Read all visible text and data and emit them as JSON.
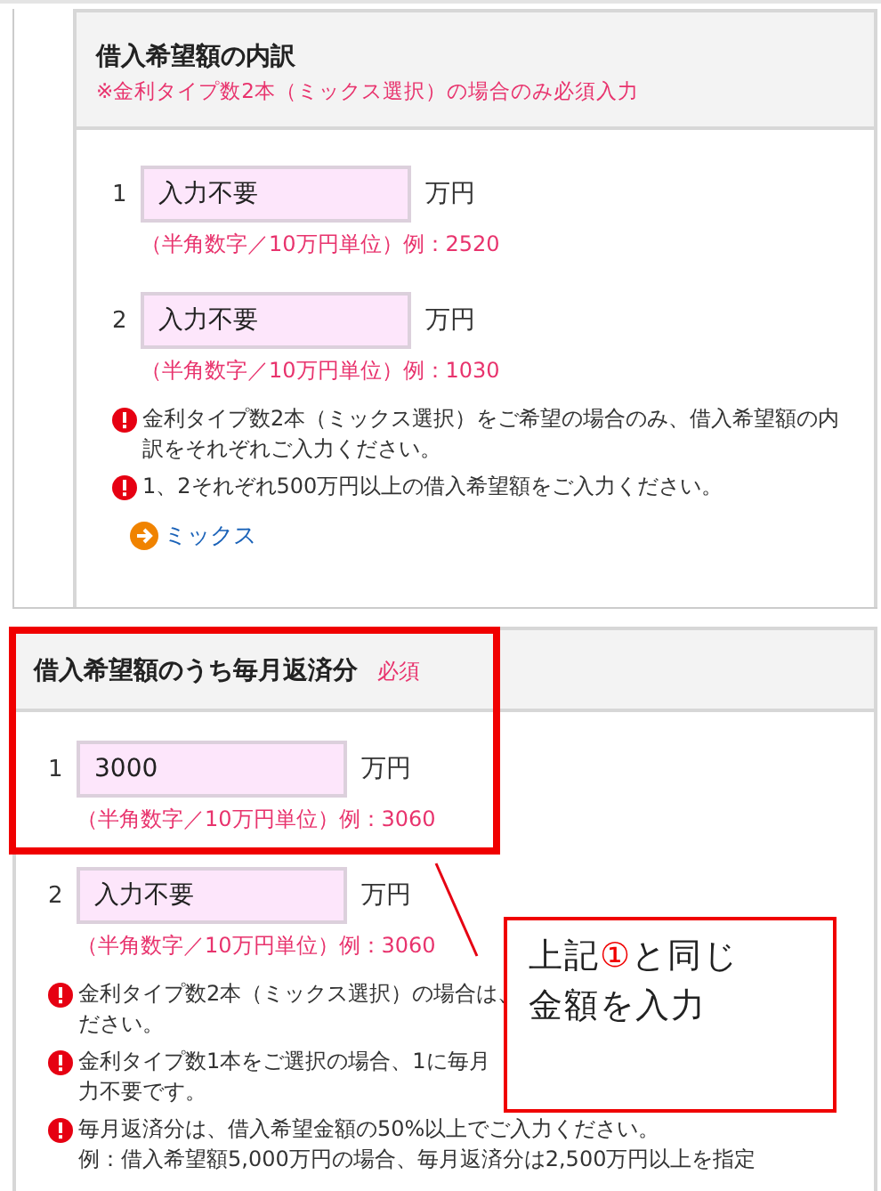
{
  "sections": [
    {
      "title": "借入希望額の内訳",
      "subtitle": "※金利タイプ数2本（ミックス選択）の場合のみ必須入力",
      "highlighted": false,
      "fields": [
        {
          "number": "1",
          "value": "入力不要",
          "unit": "万円",
          "hint": "（半角数字／10万円単位）例：2520"
        },
        {
          "number": "2",
          "value": "入力不要",
          "unit": "万円",
          "hint": "（半角数字／10万円単位）例：1030"
        }
      ],
      "notes": [
        {
          "lines": [
            "金利タイプ数2本（ミックス選択）をご希望の場合のみ、借入希望額の内訳をそれぞれご入力ください。"
          ]
        },
        {
          "lines": [
            "1、2それぞれ500万円以上の借入希望額をご入力ください。"
          ]
        }
      ],
      "link": "ミックス"
    },
    {
      "title": "借入希望額のうち毎月返済分",
      "required_badge": "必須",
      "highlighted": true,
      "fields": [
        {
          "number": "1",
          "value": "3000",
          "unit": "万円",
          "hint": "（半角数字／10万円単位）例：3060"
        },
        {
          "number": "2",
          "value": "入力不要",
          "unit": "万円",
          "hint": "（半角数字／10万円単位）例：3060"
        }
      ],
      "notes": [
        {
          "lines": [
            "金利タイプ数2本（ミックス選択）の場合は、",
            "ださい。"
          ]
        },
        {
          "lines": [
            "金利タイプ数1本をご選択の場合、1に毎月",
            "力不要です。"
          ]
        },
        {
          "lines": [
            "毎月返済分は、借入希望金額の50%以上でご入力ください。",
            "例：借入希望額5,000万円の場合、毎月返済分は2,500万円以上を指定"
          ]
        }
      ]
    }
  ],
  "callout": {
    "lines": [
      [
        {
          "text": "上記",
          "accent": false
        },
        {
          "text": "①",
          "accent": true
        },
        {
          "text": "と同じ",
          "accent": false
        }
      ],
      [
        {
          "text": "金額を入力",
          "accent": false
        }
      ]
    ]
  }
}
